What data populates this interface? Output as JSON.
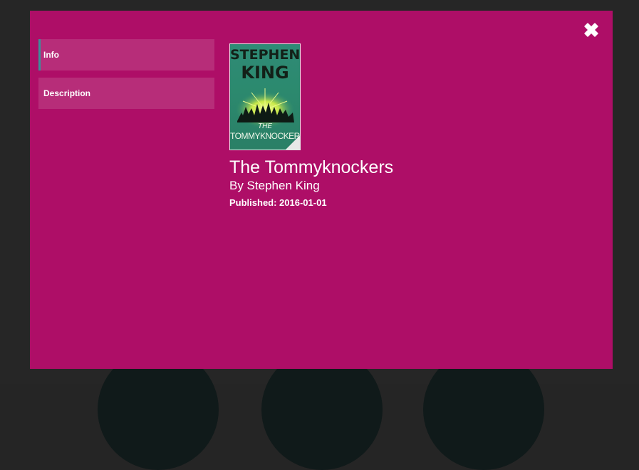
{
  "modal": {
    "close_icon": "close-x-icon",
    "tabs": [
      {
        "label": "Info",
        "active": true
      },
      {
        "label": "Description",
        "active": false
      }
    ]
  },
  "book": {
    "cover": {
      "author_line_1": "STEPHEN",
      "author_line_2": "KING",
      "title_line_1": "THE",
      "title_line_2": "TOMMYKNOCKERS"
    },
    "title": "The Tommyknockers",
    "author": "By Stephen King",
    "published": "Published: 2016-01-01"
  },
  "colors": {
    "modal_background": "#ae0e67",
    "tab_background": "#b72d79",
    "active_tab_indicator": "#3b8f99",
    "page_background": "#262626"
  }
}
